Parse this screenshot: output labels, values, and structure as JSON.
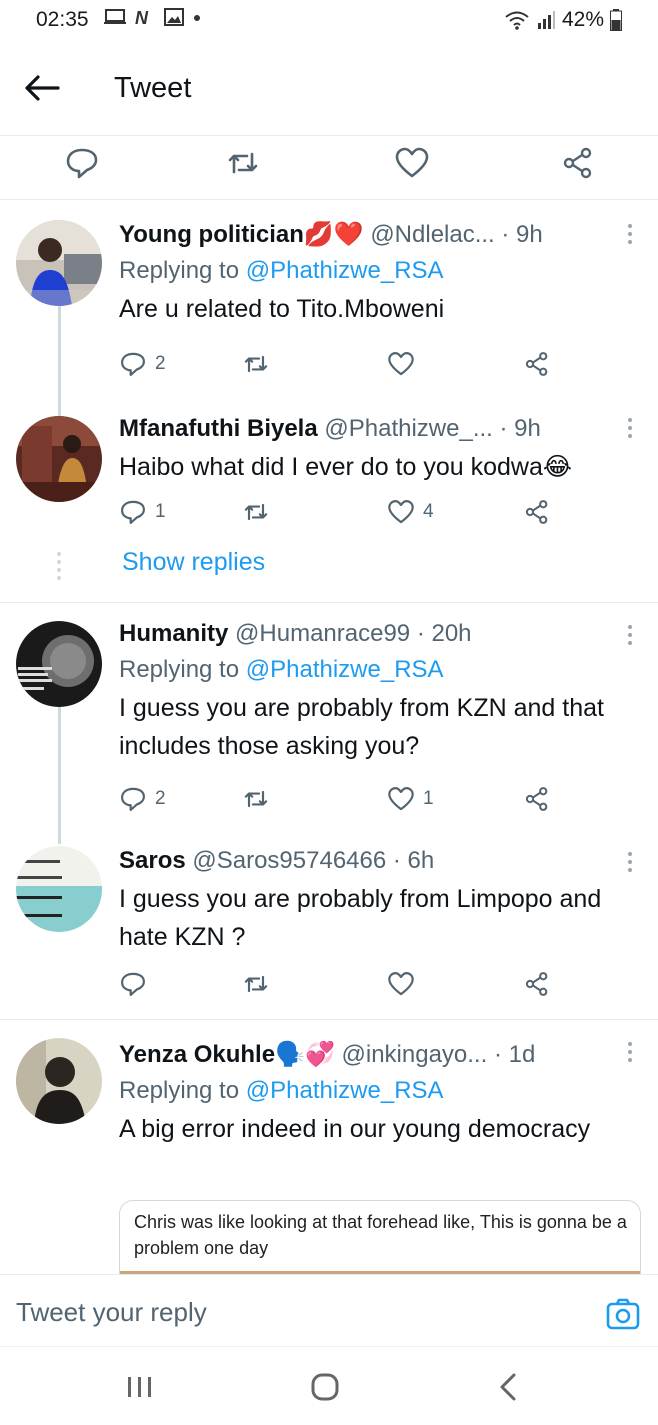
{
  "status_bar": {
    "time": "02:35",
    "battery": "42%",
    "icons_left": [
      "screen-icon",
      "n-app-icon",
      "gallery-icon",
      "dot-icon"
    ],
    "icons_right": [
      "wifi-icon",
      "signal-icon",
      "battery-icon"
    ]
  },
  "header": {
    "title": "Tweet"
  },
  "replies": [
    {
      "name": "Young politician",
      "emoji": "💋❤️",
      "handle": "@Ndlelac...",
      "time": "· 9h",
      "replying_prefix": "Replying to",
      "replying_to": "@Phathizwe_RSA",
      "text": "Are u related to Tito.Mboweni",
      "reply_count": "2",
      "retweet_count": "",
      "like_count": ""
    },
    {
      "name": "Mfanafuthi Biyela",
      "handle": "@Phathizwe_...",
      "time": "· 9h",
      "text": "Haibo what did I ever do to you kodwa😂",
      "reply_count": "1",
      "retweet_count": "",
      "like_count": "4"
    },
    {
      "name": "Humanity",
      "handle": "@Humanrace99",
      "time": "· 20h",
      "replying_prefix": "Replying to",
      "replying_to": "@Phathizwe_RSA",
      "text": "I guess you are probably from KZN and that includes those asking you?",
      "reply_count": "2",
      "retweet_count": "",
      "like_count": "1"
    },
    {
      "name": "Saros",
      "handle": "@Saros95746466",
      "time": "· 6h",
      "text": "I guess you are probably from Limpopo and hate KZN ?",
      "reply_count": "",
      "retweet_count": "",
      "like_count": ""
    },
    {
      "name": "Yenza Okuhle",
      "emoji": "🗣️💞",
      "handle": "@inkingayo...",
      "time": "· 1d",
      "replying_prefix": "Replying to",
      "replying_to": "@Phathizwe_RSA",
      "text": "A big error indeed in our young democracy",
      "media_caption": "Chris was like looking at that forehead like, This is gonna be a problem one day"
    }
  ],
  "show_replies": "Show replies",
  "composer": {
    "placeholder": "Tweet your reply"
  },
  "colors": {
    "accent": "#1d9bf0",
    "text": "#0f1419",
    "muted": "#536471",
    "divider": "#e6ecf0"
  }
}
